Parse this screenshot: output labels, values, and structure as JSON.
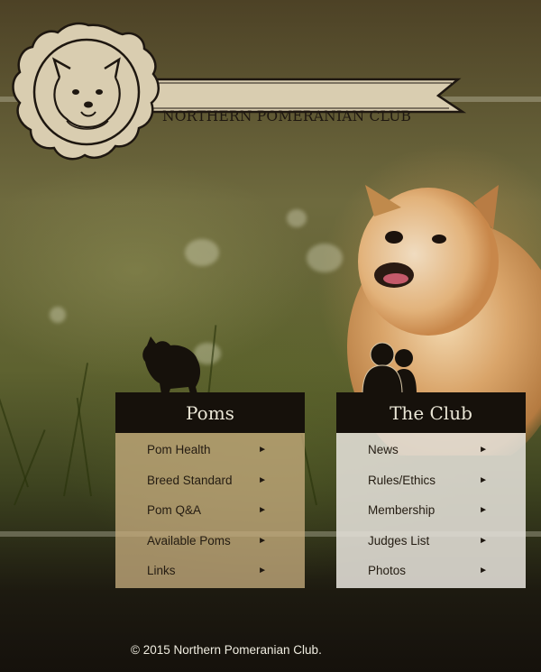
{
  "site": {
    "club_name": "NORTHERN POMERANIAN CLUB"
  },
  "poms": {
    "title": "Poms",
    "items": [
      {
        "label": "Pom Health",
        "arrow": "►"
      },
      {
        "label": "Breed Standard",
        "arrow": "►"
      },
      {
        "label": "Pom Q&A",
        "arrow": "►"
      },
      {
        "label": "Available Poms",
        "arrow": "►"
      },
      {
        "label": "Links",
        "arrow": "►"
      }
    ]
  },
  "club": {
    "title": "The Club",
    "items": [
      {
        "label": "News",
        "arrow": "►"
      },
      {
        "label": "Rules/Ethics",
        "arrow": "►"
      },
      {
        "label": "Membership",
        "arrow": "►"
      },
      {
        "label": "Judges List",
        "arrow": "►"
      },
      {
        "label": "Photos",
        "arrow": "►"
      }
    ]
  },
  "footer": {
    "copyright": "© 2015 Northern Pomeranian Club."
  },
  "colors": {
    "panel_head": "#16110b",
    "poms_body": "#c4aa7c",
    "club_body": "#e4e0d8",
    "logo_fill": "#d9cdb0",
    "logo_stroke": "#1e1710"
  },
  "icons": {
    "logo": "pomeranian-rosette-icon",
    "poms": "pomeranian-silhouette-icon",
    "club": "people-silhouette-icon",
    "arrow": "triangle-right"
  }
}
